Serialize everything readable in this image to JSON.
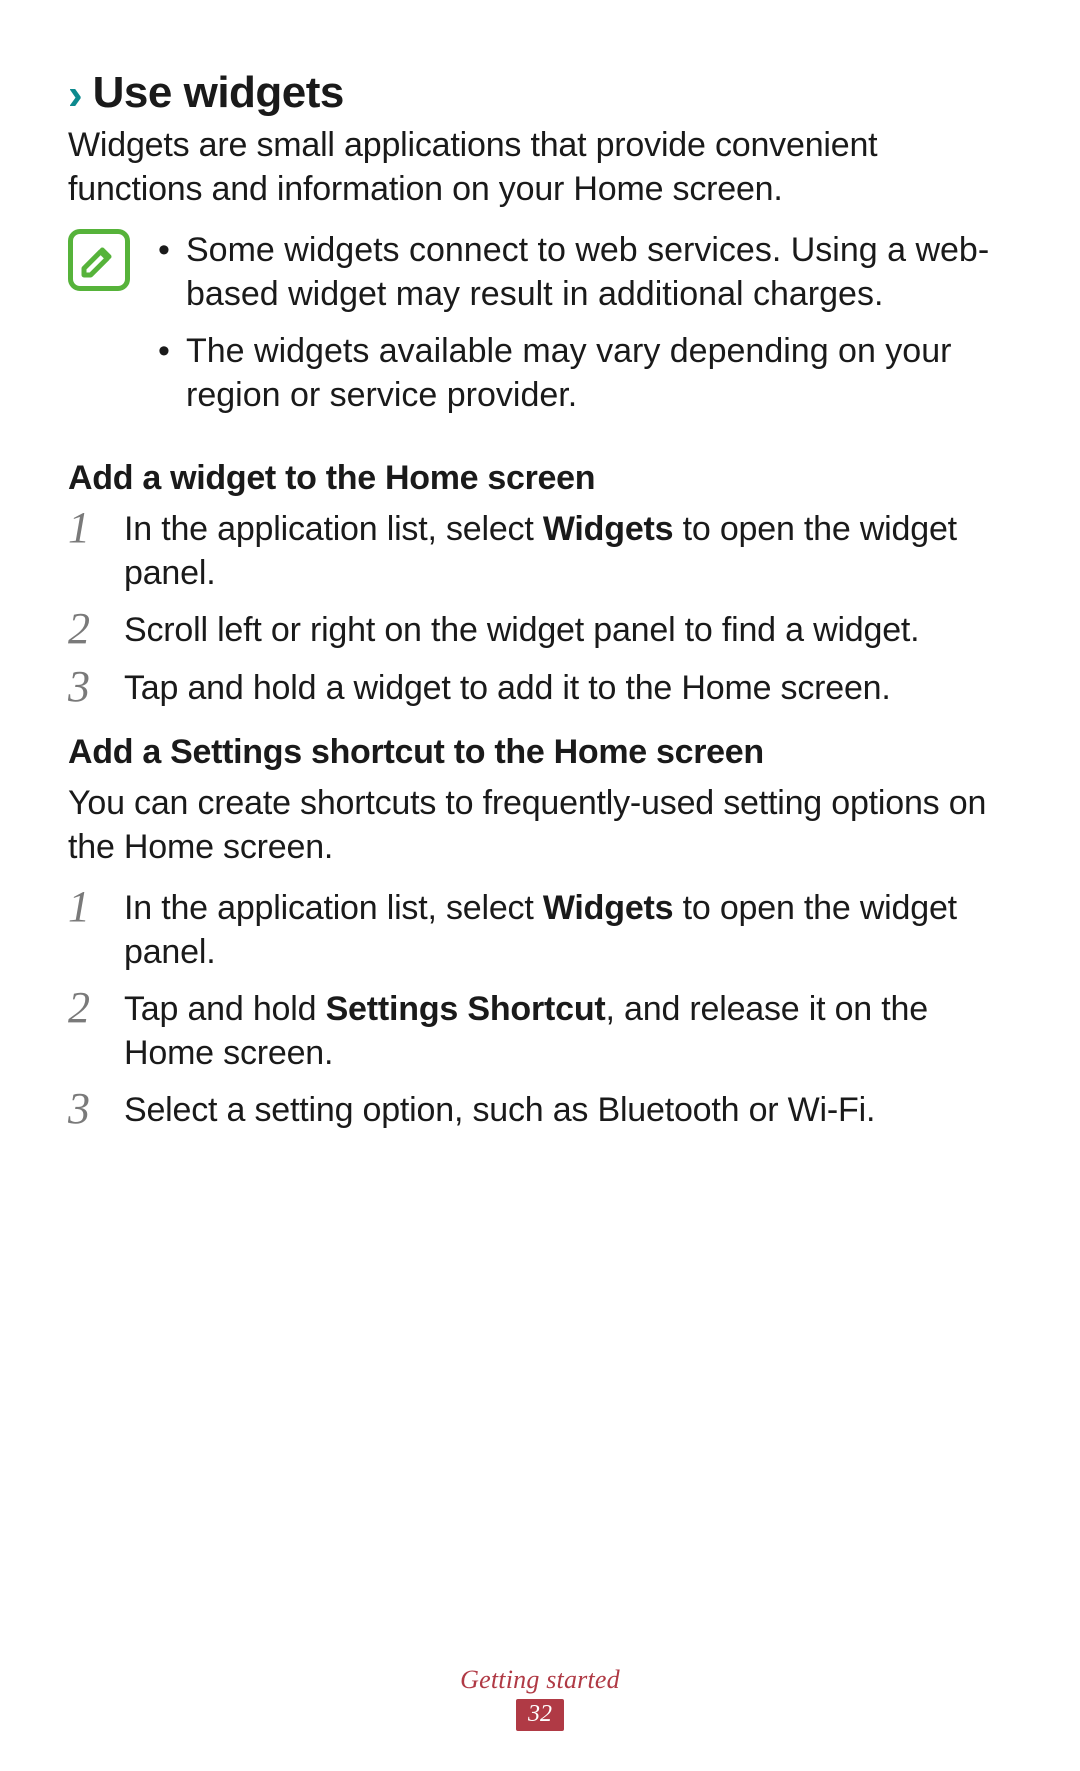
{
  "heading": {
    "chevron": "›",
    "title": "Use widgets"
  },
  "intro": "Widgets are small applications that provide convenient functions and information on your Home screen.",
  "notes": {
    "items": [
      "Some widgets connect to web services. Using a web-based widget may result in additional charges.",
      "The widgets available may vary depending on your region or service provider."
    ]
  },
  "sectionA": {
    "title": "Add a widget to the Home screen",
    "steps": [
      {
        "n": "1",
        "pre": "In the application list, select ",
        "bold": "Widgets",
        "post": " to open the widget panel."
      },
      {
        "n": "2",
        "pre": "Scroll left or right on the widget panel to find a widget.",
        "bold": "",
        "post": ""
      },
      {
        "n": "3",
        "pre": "Tap and hold a widget to add it to the Home screen.",
        "bold": "",
        "post": ""
      }
    ]
  },
  "sectionB": {
    "title": "Add a Settings shortcut to the Home screen",
    "intro": "You can create shortcuts to frequently-used setting options on the Home screen.",
    "steps": [
      {
        "n": "1",
        "pre": "In the application list, select ",
        "bold": "Widgets",
        "post": " to open the widget panel."
      },
      {
        "n": "2",
        "pre": "Tap and hold ",
        "bold": "Settings Shortcut",
        "post": ", and release it on the Home screen."
      },
      {
        "n": "3",
        "pre": "Select a setting option, such as Bluetooth or Wi-Fi.",
        "bold": "",
        "post": ""
      }
    ]
  },
  "footer": {
    "section": "Getting started",
    "page": "32"
  }
}
